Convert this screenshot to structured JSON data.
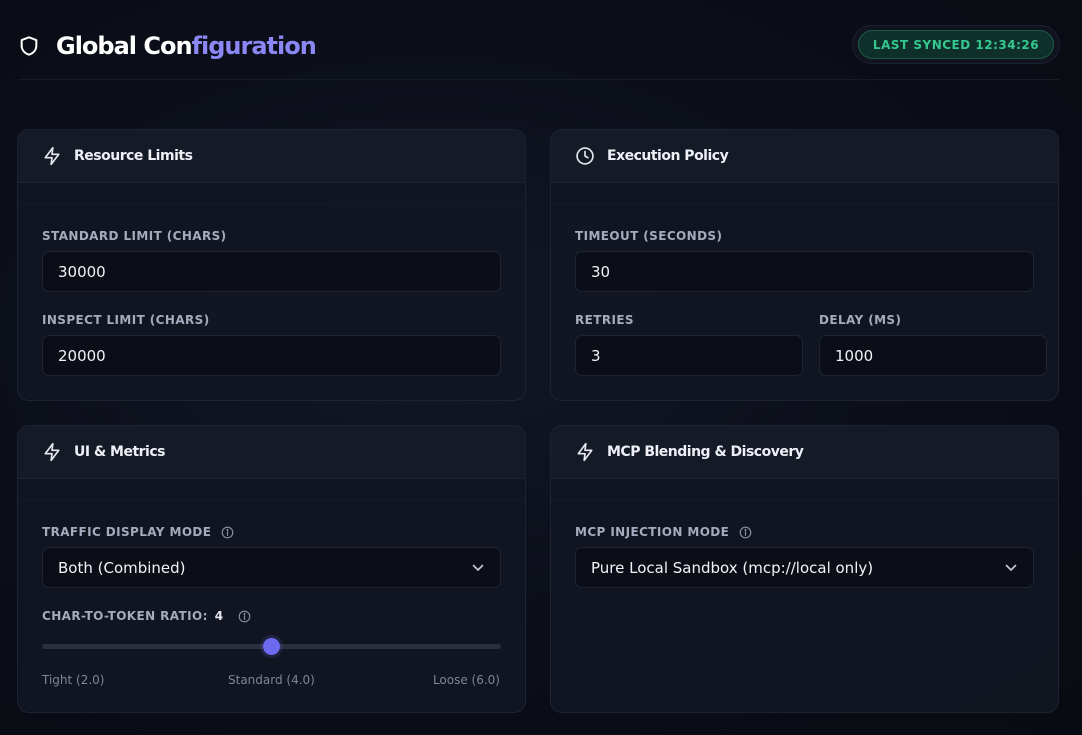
{
  "header": {
    "title_main": "Global Con",
    "title_accent": "figuration",
    "sync_status": "LAST SYNCED 12:34:26"
  },
  "resource_limits": {
    "title": "Resource Limits",
    "standard_label": "STANDARD LIMIT (CHARS)",
    "standard_value": "30000",
    "inspect_label": "INSPECT LIMIT (CHARS)",
    "inspect_value": "20000"
  },
  "execution_policy": {
    "title": "Execution Policy",
    "timeout_label": "TIMEOUT (SECONDS)",
    "timeout_value": "30",
    "retries_label": "RETRIES",
    "retries_value": "3",
    "delay_label": "DELAY (MS)",
    "delay_value": "1000"
  },
  "ui_metrics": {
    "title": "UI & Metrics",
    "traffic_label": "TRAFFIC DISPLAY MODE",
    "traffic_value": "Both (Combined)",
    "ratio_label": "CHAR-TO-TOKEN RATIO:",
    "ratio_value": "4",
    "ratio_min": 2.0,
    "ratio_max": 6.0,
    "ratio_current": 4.0,
    "tick_low": "Tight (2.0)",
    "tick_mid": "Standard (4.0)",
    "tick_high": "Loose (6.0)"
  },
  "mcp": {
    "title": "MCP Blending & Discovery",
    "injection_label": "MCP INJECTION MODE",
    "injection_value": "Pure Local Sandbox (mcp://local only)"
  },
  "colors": {
    "accent": "#8b87f5",
    "slider": "#6d6af0",
    "sync_green": "#34c88f"
  }
}
